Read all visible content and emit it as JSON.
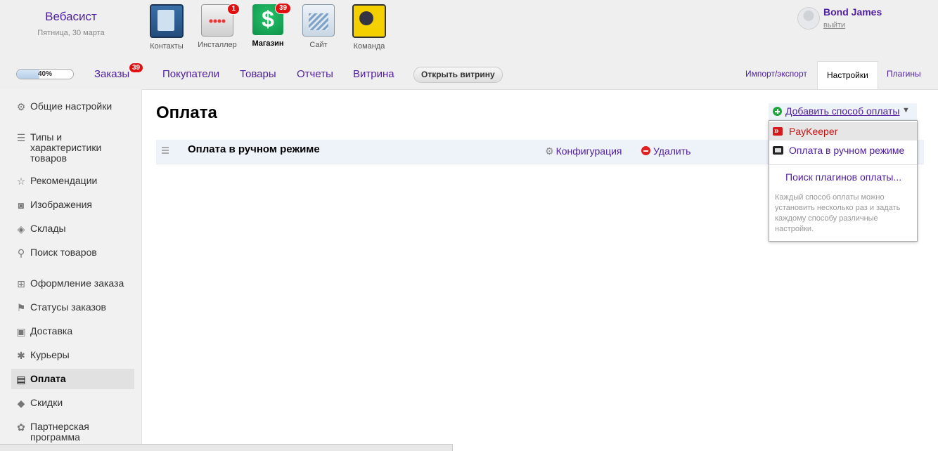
{
  "brand": {
    "name": "Вебасист",
    "date": "Пятница, 30 марта"
  },
  "apps": [
    {
      "label": "Контакты",
      "icon": "contacts-icon"
    },
    {
      "label": "Инсталлер",
      "icon": "installer-icon",
      "badge": "1"
    },
    {
      "label": "Магазин",
      "icon": "shop-icon",
      "badge": "39",
      "glyph": "$"
    },
    {
      "label": "Сайт",
      "icon": "site-icon"
    },
    {
      "label": "Команда",
      "icon": "team-icon"
    }
  ],
  "user": {
    "name": "Bond James",
    "logout": "выйти"
  },
  "nav": {
    "progress": "40%",
    "progress_value": 0.4,
    "items": [
      "Заказы",
      "Покупатели",
      "Товары",
      "Отчеты",
      "Витрина"
    ],
    "orders_badge": "39",
    "open_storefront": "Открыть витрину",
    "right_tabs": [
      "Импорт/экспорт",
      "Настройки",
      "Плагины"
    ]
  },
  "sidebar": {
    "items": [
      {
        "label": "Общие настройки",
        "icon": "gears-icon"
      },
      {
        "label": "Типы и характеристики товаров",
        "icon": "list-icon"
      },
      {
        "label": "Рекомендации",
        "icon": "star-icon"
      },
      {
        "label": "Изображения",
        "icon": "camera-icon"
      },
      {
        "label": "Склады",
        "icon": "box-icon"
      },
      {
        "label": "Поиск товаров",
        "icon": "search-icon"
      },
      {
        "label": "Оформление заказа",
        "icon": "cart-icon"
      },
      {
        "label": "Статусы заказов",
        "icon": "flag-icon"
      },
      {
        "label": "Доставка",
        "icon": "truck-icon"
      },
      {
        "label": "Курьеры",
        "icon": "courier-icon"
      },
      {
        "label": "Оплата",
        "icon": "cash-icon"
      },
      {
        "label": "Скидки",
        "icon": "tag-icon"
      },
      {
        "label": "Партнерская программа",
        "icon": "affiliate-icon"
      }
    ]
  },
  "main": {
    "title": "Оплата",
    "payment": {
      "name": "Оплата в ручном режиме",
      "configure": "Конфигурация",
      "delete": "Удалить"
    },
    "add_button": "Добавить способ оплаты",
    "dropdown": {
      "items": [
        "PayKeeper",
        "Оплата в ручном режиме"
      ],
      "search": "Поиск плагинов оплаты...",
      "note": "Каждый способ оплаты можно установить несколько раз и задать каждому способу различные настройки."
    }
  },
  "colors": {
    "link": "#5020a0",
    "badge": "#e01010",
    "add": "#1fa73b",
    "delete": "#e02020"
  }
}
